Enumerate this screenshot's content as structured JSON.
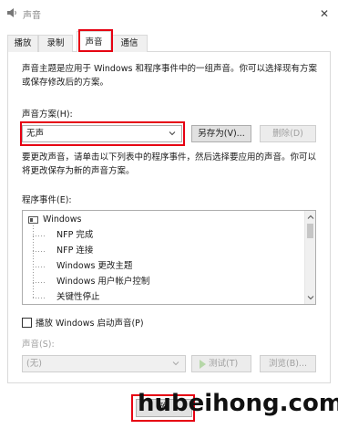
{
  "window": {
    "title": "声音",
    "close_glyph": "✕"
  },
  "tabs": [
    {
      "label": "播放"
    },
    {
      "label": "录制"
    },
    {
      "label": "声音"
    },
    {
      "label": "通信"
    }
  ],
  "sounds_tab": {
    "intro": "声音主题是应用于 Windows 和程序事件中的一组声音。你可以选择现有方案或保存修改后的方案。",
    "scheme_label": "声音方案(H):",
    "scheme_value": "无声",
    "save_as_label": "另存为(V)...",
    "delete_label": "删除(D)",
    "description": "要更改声音，请单击以下列表中的程序事件，然后选择要应用的声音。你可以将更改保存为新的声音方案。",
    "events_label": "程序事件(E):",
    "events_root": "Windows",
    "events": [
      "NFP 完成",
      "NFP 连接",
      "Windows 更改主题",
      "Windows 用户帐户控制",
      "关键性停止"
    ],
    "startup_label": "播放 Windows 启动声音(P)",
    "startup_checked": false,
    "sound_label": "声音(S):",
    "sound_value": "(无)",
    "test_label": "测试(T)",
    "browse_label": "浏览(B)..."
  },
  "footer": {
    "ok_label": "确"
  },
  "watermark": "hubeihong.com",
  "icons": {
    "window": "speaker-icon",
    "events_root": "windows-window-icon"
  },
  "colors": {
    "highlight": "#e60012"
  }
}
